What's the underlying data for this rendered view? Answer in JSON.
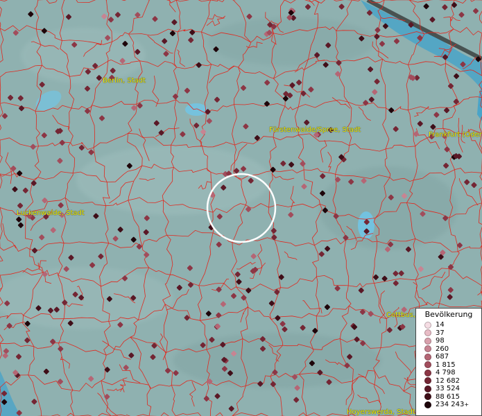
{
  "map": {
    "base_color": "#8fb1b0",
    "boundary_color": "#e0281e",
    "marker_color": "#6b1f2c",
    "water_color": "#6ec8ec",
    "labels": {
      "berlin": "Berlin, Stadt",
      "fuerstenwalde": "Fürstenwalde/Spree, Stadt",
      "frankfurt": "Frankfurt (Oder",
      "luckenwalde": "Luckenwalde, Stadt",
      "cottbus": "Cottbus,",
      "hoyerswerda": "Hoyerswerda, Stadt"
    },
    "selection_marker": "white-circle"
  },
  "legend": {
    "title": "Bevölkerung",
    "items": [
      {
        "label": "14",
        "color": "#f5dde4"
      },
      {
        "label": "37",
        "color": "#e8bcc6"
      },
      {
        "label": "98",
        "color": "#d9a1ad"
      },
      {
        "label": "260",
        "color": "#c78492"
      },
      {
        "label": "687",
        "color": "#b56675"
      },
      {
        "label": "1 815",
        "color": "#a24d5c"
      },
      {
        "label": "4 798",
        "color": "#8c3645"
      },
      {
        "label": "12 682",
        "color": "#742634"
      },
      {
        "label": "33 524",
        "color": "#5a1826"
      },
      {
        "label": "88 615",
        "color": "#3f0e18"
      },
      {
        "label": "234 243",
        "color": "#1e050a"
      }
    ],
    "last_suffix": "+"
  }
}
